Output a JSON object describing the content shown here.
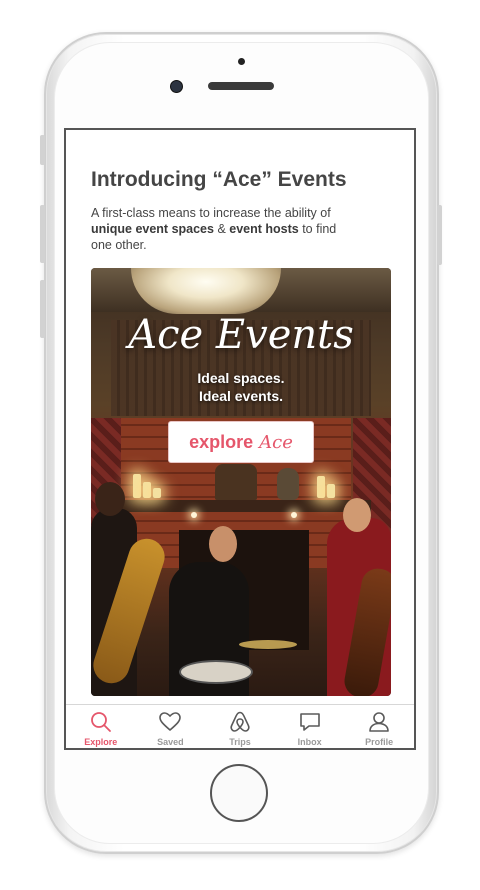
{
  "content": {
    "headline": "Introducing “Ace” Events",
    "intro_prefix": "A first-class means to increase the ability of ",
    "intro_bold_1": "unique event spaces",
    "intro_mid": " & ",
    "intro_bold_2": "event hosts",
    "intro_suffix": " to find one other."
  },
  "promo": {
    "title": "Ace Events",
    "tagline_1": "Ideal spaces.",
    "tagline_2": "Ideal events.",
    "cta_word": "explore",
    "cta_brand": "Ace"
  },
  "tabbar": {
    "active": "Explore",
    "active_color": "#e5566b",
    "inactive_color": "#9a9a9a",
    "tabs": [
      {
        "label": "Explore",
        "icon": "search-icon"
      },
      {
        "label": "Saved",
        "icon": "heart-icon"
      },
      {
        "label": "Trips",
        "icon": "airbnb-logo-icon"
      },
      {
        "label": "Inbox",
        "icon": "chat-bubble-icon"
      },
      {
        "label": "Profile",
        "icon": "user-icon"
      }
    ]
  }
}
